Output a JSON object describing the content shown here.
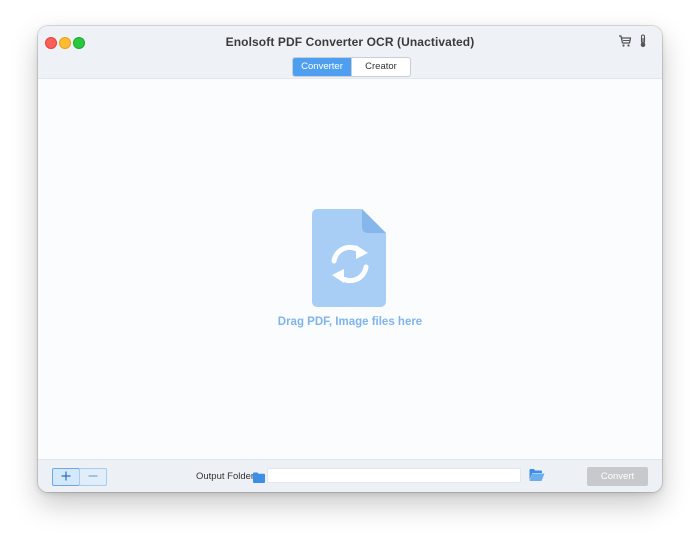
{
  "window": {
    "title": "Enolsoft PDF Converter OCR (Unactivated)"
  },
  "toolbar_icons": [
    "cart-icon",
    "thermometer-icon"
  ],
  "tabs": [
    {
      "label": "Converter",
      "active": true
    },
    {
      "label": "Creator",
      "active": false
    }
  ],
  "dropzone": {
    "icon": "document-convert-icon",
    "text": "Drag PDF, Image files here"
  },
  "bottom": {
    "add_icon": "plus-icon",
    "remove_icon": "minus-icon",
    "output_label": "Output Folder",
    "output_value": "",
    "folder_icon": "folder-icon",
    "open_icon": "open-folder-icon",
    "convert_label": "Convert"
  },
  "colors": {
    "accent": "#4f9ff0",
    "drop_text": "#7fb4ec",
    "doc_icon": "#a8cef6",
    "convert_disabled": "#c7c9cc"
  }
}
